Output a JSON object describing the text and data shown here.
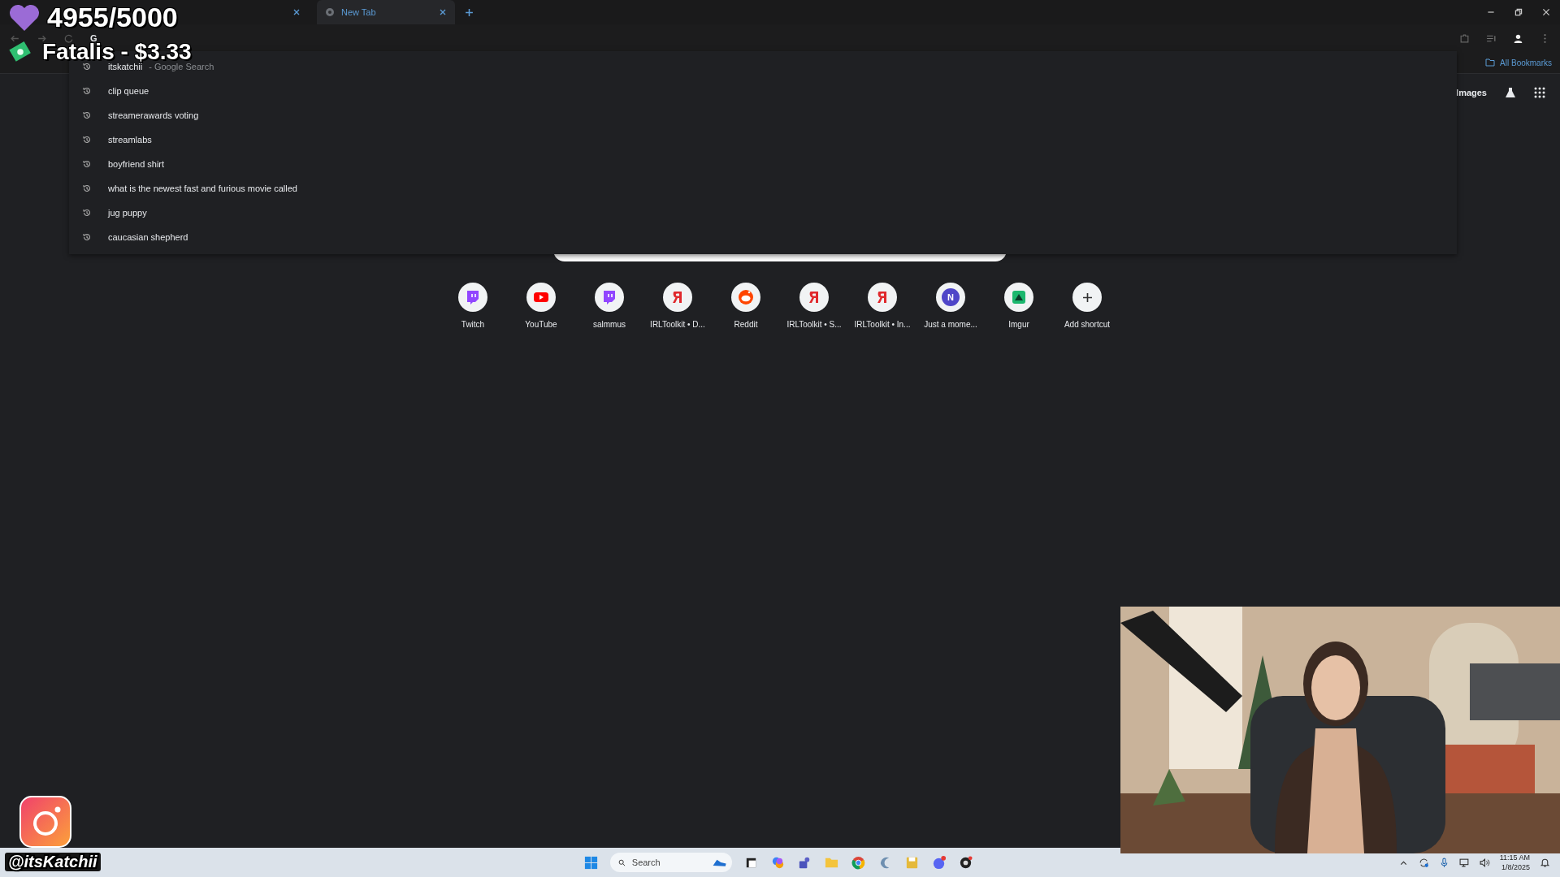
{
  "browser": {
    "tabs": [
      {
        "selected": false
      },
      {
        "title": "New Tab",
        "selected": true
      }
    ],
    "address_icon": "G",
    "bookmarks": {
      "label": "All Bookmarks"
    },
    "suggestions": [
      {
        "text": "itskatchii",
        "suffix": "- Google Search"
      },
      {
        "text": "clip queue"
      },
      {
        "text": "streamerawards voting"
      },
      {
        "text": "streamlabs"
      },
      {
        "text": "boyfriend shirt"
      },
      {
        "text": "what is the newest fast and furious movie called"
      },
      {
        "text": "jug puppy"
      },
      {
        "text": "caucasian shepherd"
      }
    ],
    "top_links": {
      "images": "Images"
    },
    "shortcuts": [
      {
        "label": "Twitch",
        "kind": "twitch"
      },
      {
        "label": "YouTube",
        "kind": "youtube"
      },
      {
        "label": "salmmus",
        "kind": "twitch"
      },
      {
        "label": "IRLToolkit • D...",
        "kind": "toolkit"
      },
      {
        "label": "Reddit",
        "kind": "reddit"
      },
      {
        "label": "IRLToolkit • S...",
        "kind": "toolkit"
      },
      {
        "label": "IRLToolkit • In...",
        "kind": "toolkit"
      },
      {
        "label": "Just a mome...",
        "kind": "letter",
        "badge": "N"
      },
      {
        "label": "Imgur",
        "kind": "imgur"
      },
      {
        "label": "Add shortcut",
        "kind": "add"
      }
    ]
  },
  "taskbar": {
    "search_placeholder": "Search",
    "time": "11:15 AM",
    "date": "1/8/2025"
  },
  "overlay": {
    "goal": "4955/5000",
    "donation": "Fatalis - $3.33",
    "handle": "@itsKatchii"
  }
}
